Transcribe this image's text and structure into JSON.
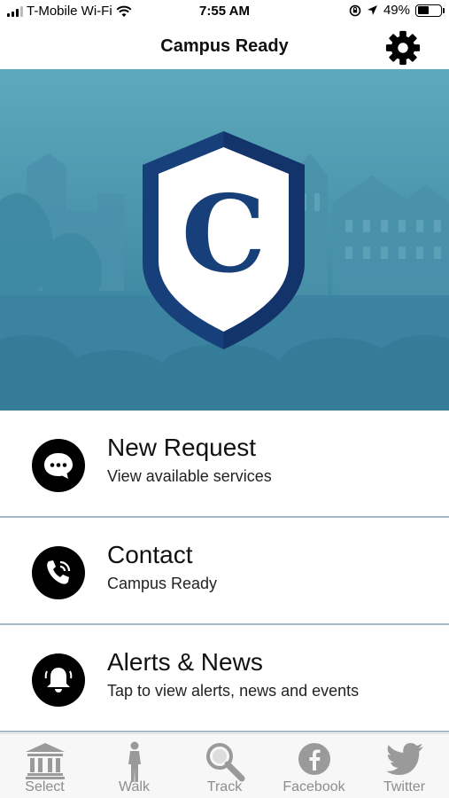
{
  "status_bar": {
    "carrier": "T-Mobile Wi-Fi",
    "time": "7:55 AM",
    "battery": "49%",
    "battery_level": 0.49
  },
  "nav": {
    "title": "Campus Ready",
    "settings_icon": "gear-icon"
  },
  "hero": {
    "logo_letter": "C",
    "shield_color": "#173f7a"
  },
  "menu": [
    {
      "title": "New Request",
      "subtitle": "View available services",
      "icon": "chat-bubble-icon"
    },
    {
      "title": "Contact",
      "subtitle": "Campus Ready",
      "icon": "phone-icon"
    },
    {
      "title": "Alerts & News",
      "subtitle": "Tap to view alerts, news and events",
      "icon": "bell-icon"
    }
  ],
  "tabs": [
    {
      "label": "Select",
      "icon": "building-icon"
    },
    {
      "label": "Walk",
      "icon": "walking-person-icon"
    },
    {
      "label": "Track",
      "icon": "magnifier-icon"
    },
    {
      "label": "Facebook",
      "icon": "facebook-icon"
    },
    {
      "label": "Twitter",
      "icon": "twitter-bird-icon"
    }
  ],
  "colors": {
    "hero_blue": "#4f99b0",
    "divider": "#a5b9c9",
    "tab_gray": "#8d8d8d"
  }
}
